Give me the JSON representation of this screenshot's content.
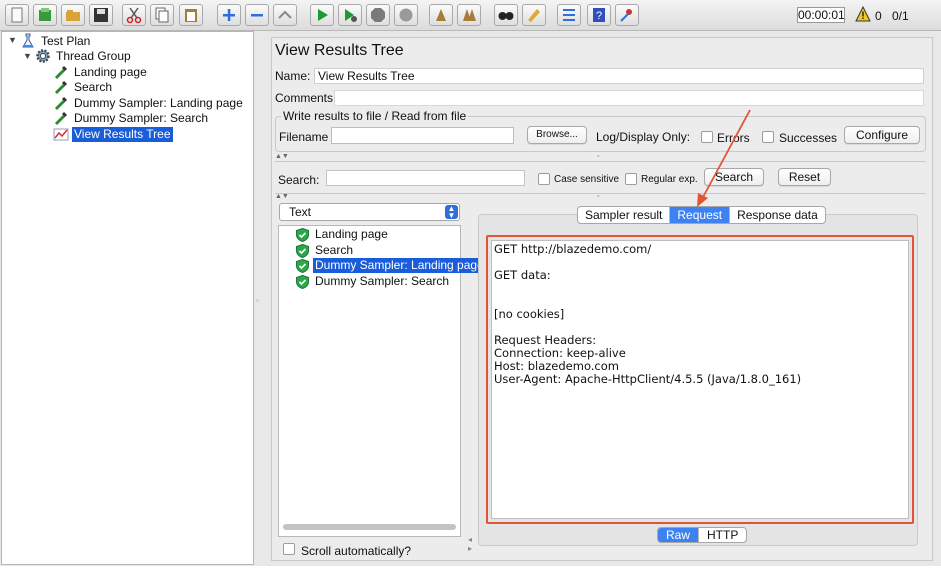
{
  "toolbar": {
    "buttons": [
      {
        "icon": "new-icon",
        "color": "#f0f0f0"
      },
      {
        "icon": "templates-icon",
        "color": "#3a9a3a"
      },
      {
        "icon": "open-icon",
        "color": "#d9a335"
      },
      {
        "icon": "save-icon",
        "color": "#333333"
      },
      {
        "icon": "cut-icon",
        "color": "#cc2222"
      },
      {
        "icon": "copy-icon",
        "color": "#666666"
      },
      {
        "icon": "paste-icon",
        "color": "#a87b3a"
      },
      {
        "icon": "expand-icon",
        "color": "#2f6fdc"
      },
      {
        "icon": "collapse-icon",
        "color": "#2f6fdc"
      },
      {
        "icon": "toggle-icon",
        "color": "#888888"
      },
      {
        "icon": "start-icon",
        "color": "#1f9a2f"
      },
      {
        "icon": "start-no-pauses-icon",
        "color": "#1f9a2f"
      },
      {
        "icon": "stop-icon",
        "color": "#7a7a7a"
      },
      {
        "icon": "shutdown-icon",
        "color": "#9a9a9a"
      },
      {
        "icon": "clear-icon",
        "color": "#a87b3a"
      },
      {
        "icon": "clear-all-icon",
        "color": "#a87b3a"
      },
      {
        "icon": "search-icon",
        "color": "#222222"
      },
      {
        "icon": "reset-search-icon",
        "color": "#e0a82e"
      },
      {
        "icon": "function-helper-icon",
        "color": "#2f6fdc"
      },
      {
        "icon": "help-icon",
        "color": "#2f4fbf"
      },
      {
        "icon": "remote-icon",
        "color": "#cc3333"
      }
    ],
    "timer": "00:00:01",
    "warning_count": "0",
    "threads": "0/1"
  },
  "tree": {
    "items": [
      {
        "label": "Test Plan",
        "icon": "test-plan-icon"
      },
      {
        "label": "Thread Group",
        "icon": "gear-icon"
      },
      {
        "label": "Landing page",
        "icon": "pipette-icon"
      },
      {
        "label": "Search",
        "icon": "pipette-icon"
      },
      {
        "label": "Dummy Sampler: Landing page",
        "icon": "pipette-icon"
      },
      {
        "label": "Dummy Sampler: Search",
        "icon": "pipette-icon"
      },
      {
        "label": "View Results Tree",
        "icon": "chart-icon",
        "selected": true
      }
    ]
  },
  "panel": {
    "title": "View Results Tree",
    "name_label": "Name:",
    "name_value": "View Results Tree",
    "comments_label": "Comments:",
    "file_group_title": "Write results to file / Read from file",
    "filename_label": "Filename",
    "browse_label": "Browse...",
    "log_display_label": "Log/Display Only:",
    "errors_label": "Errors",
    "successes_label": "Successes",
    "configure_label": "Configure"
  },
  "search": {
    "label": "Search:",
    "case_sensitive_label": "Case sensitive",
    "regex_label": "Regular exp.",
    "search_button": "Search",
    "reset_button": "Reset"
  },
  "results": {
    "renderer": "Text",
    "items": [
      {
        "label": "Landing page"
      },
      {
        "label": "Search"
      },
      {
        "label": "Dummy Sampler: Landing page",
        "selected": true
      },
      {
        "label": "Dummy Sampler: Search"
      }
    ],
    "scroll_auto_label": "Scroll automatically?"
  },
  "detail": {
    "tabs": [
      "Sampler result",
      "Request",
      "Response data"
    ],
    "active_tab": "Request",
    "request_text": "GET http://blazedemo.com/\n\nGET data:\n\n\n[no cookies]\n\nRequest Headers:\nConnection: keep-alive\nHost: blazedemo.com\nUser-Agent: Apache-HttpClient/4.5.5 (Java/1.8.0_161)",
    "format_tabs": [
      "Raw",
      "HTTP"
    ],
    "active_format": "Raw"
  },
  "colors": {
    "selection": "#1a5dd8",
    "active_tab": "#3d82f0",
    "annotation": "#e05536"
  }
}
